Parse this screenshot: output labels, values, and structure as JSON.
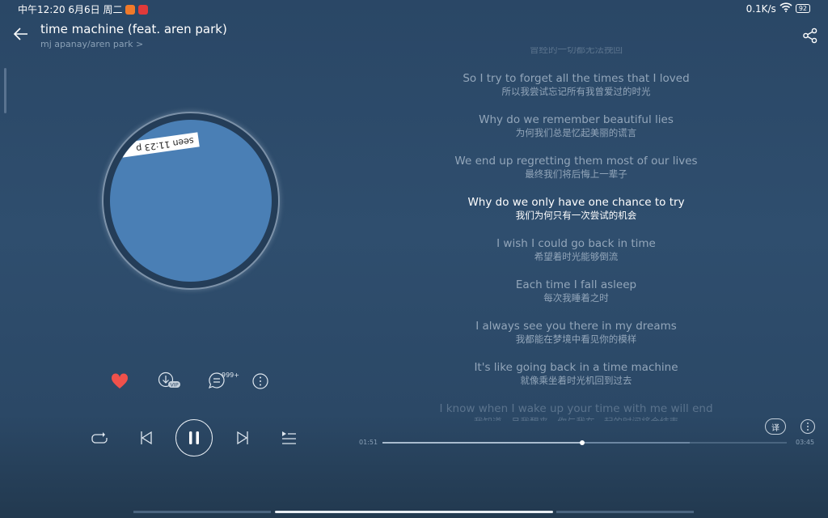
{
  "status_bar": {
    "time": "中午12:20 6月6日 周二",
    "network_speed": "0.1K/s",
    "battery": "92"
  },
  "header": {
    "title": "time machine (feat. aren park)",
    "artist": "mj apanay/aren park >"
  },
  "artwork": {
    "sticker_text": "seen 11:23 p"
  },
  "actions": {
    "comment_count": "999+",
    "download_badge": "VIP",
    "liked": true,
    "like_color": "#f0514b"
  },
  "lyrics": [
    {
      "en": "",
      "zh": "曾经的一切都无法挽回",
      "state": "faded"
    },
    {
      "en": "So I try to forget all the times that I loved",
      "zh": "所以我尝试忘记所有我曾爱过的时光"
    },
    {
      "en": "Why do we remember beautiful lies",
      "zh": "为何我们总是忆起美丽的谎言"
    },
    {
      "en": "We end up regretting them most of our lives",
      "zh": "最终我们将后悔上一辈子"
    },
    {
      "en": "Why do we only have one chance to try",
      "zh": "我们为何只有一次尝试的机会",
      "state": "current"
    },
    {
      "en": "I wish I could go back in time",
      "zh": "希望着时光能够倒流"
    },
    {
      "en": "Each time I fall asleep",
      "zh": "每次我睡着之时"
    },
    {
      "en": "I always see you there in my dreams",
      "zh": "我都能在梦境中看见你的模样"
    },
    {
      "en": "It's like going back in a time machine",
      "zh": "就像乘坐着时光机回到过去"
    },
    {
      "en": "I know when I wake up your time with me will end",
      "zh": "我知道一旦我醒来，你与我在一起的时间将会结束",
      "state": "faded"
    }
  ],
  "translate_button": "译",
  "player": {
    "elapsed": "01:51",
    "duration": "03:45",
    "progress": 0.493,
    "buffered": 0.76,
    "state": "playing"
  }
}
